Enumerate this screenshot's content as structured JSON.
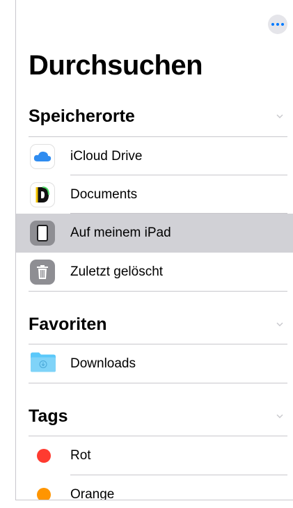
{
  "header": {
    "title": "Durchsuchen",
    "more_icon": "ellipsis-icon"
  },
  "locations": {
    "title": "Speicherorte",
    "items": [
      {
        "label": "iCloud Drive",
        "icon": "icloud-icon"
      },
      {
        "label": "Documents",
        "icon": "documents-app-icon"
      },
      {
        "label": "Auf meinem iPad",
        "icon": "ipad-icon",
        "selected": true
      },
      {
        "label": "Zuletzt gelöscht",
        "icon": "trash-icon"
      }
    ]
  },
  "favorites": {
    "title": "Favoriten",
    "items": [
      {
        "label": "Downloads",
        "icon": "downloads-folder-icon"
      }
    ]
  },
  "tags": {
    "title": "Tags",
    "items": [
      {
        "label": "Rot",
        "color": "#ff3b30"
      },
      {
        "label": "Orange",
        "color": "#ff9500"
      }
    ]
  },
  "colors": {
    "accent": "#007aff",
    "selected_row": "#d1d1d6"
  }
}
